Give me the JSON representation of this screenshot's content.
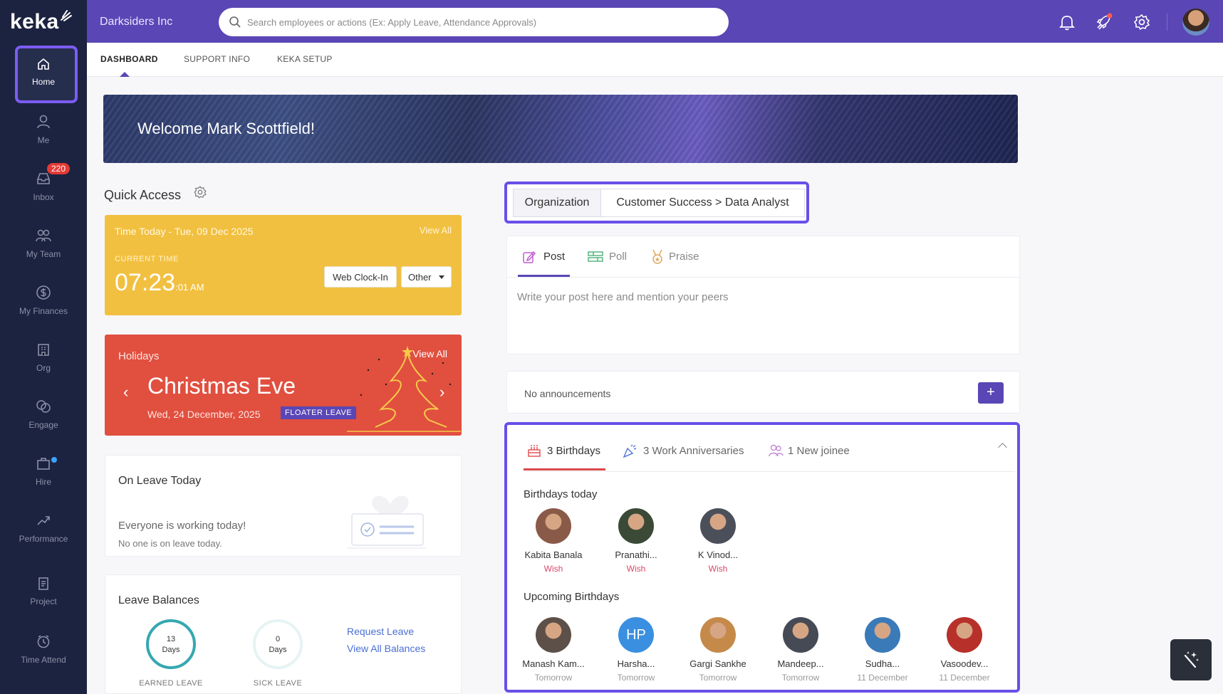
{
  "app": {
    "logo": "keka",
    "company": "Darksiders Inc"
  },
  "search": {
    "placeholder": "Search employees or actions (Ex: Apply Leave, Attendance Approvals)"
  },
  "sidebar": {
    "items": [
      {
        "label": "Home",
        "icon": "home-icon"
      },
      {
        "label": "Me",
        "icon": "user-icon"
      },
      {
        "label": "Inbox",
        "icon": "inbox-icon",
        "badge": "220"
      },
      {
        "label": "My Team",
        "icon": "team-icon"
      },
      {
        "label": "My Finances",
        "icon": "dollar-icon"
      },
      {
        "label": "Org",
        "icon": "building-icon"
      },
      {
        "label": "Engage",
        "icon": "engage-icon"
      },
      {
        "label": "Hire",
        "icon": "briefcase-icon"
      },
      {
        "label": "Performance",
        "icon": "trend-icon"
      },
      {
        "label": "Project",
        "icon": "clipboard-icon"
      },
      {
        "label": "Time Attend",
        "icon": "clock-icon"
      }
    ]
  },
  "subnav": {
    "tabs": [
      "DASHBOARD",
      "SUPPORT INFO",
      "KEKA SETUP"
    ],
    "active": "DASHBOARD"
  },
  "banner": {
    "text": "Welcome Mark Scottfield!"
  },
  "quick_access": {
    "title": "Quick Access"
  },
  "time_card": {
    "title": "Time Today - Tue, 09 Dec 2025",
    "view_all": "View All",
    "label": "CURRENT TIME",
    "time_main": "07:23",
    "time_sec": ":01 AM",
    "clock_in": "Web Clock-In",
    "other": "Other"
  },
  "holiday_card": {
    "title": "Holidays",
    "view_all": "View All",
    "name": "Christmas Eve",
    "date": "Wed, 24 December, 2025",
    "tag": "FLOATER LEAVE"
  },
  "on_leave": {
    "title": "On Leave Today",
    "message": "Everyone is working today!",
    "sub": "No one is on leave today."
  },
  "leave_balances": {
    "title": "Leave Balances",
    "items": [
      {
        "value": "13",
        "unit": "Days",
        "label": "EARNED LEAVE",
        "fill": 1.0
      },
      {
        "value": "0",
        "unit": "Days",
        "label": "SICK LEAVE",
        "fill": 0.0
      }
    ],
    "request": "Request Leave",
    "view_all": "View All Balances"
  },
  "feed_scope": {
    "org": "Organization",
    "team": "Customer Success > Data Analyst"
  },
  "post": {
    "tabs": [
      "Post",
      "Poll",
      "Praise"
    ],
    "placeholder": "Write your post here and mention your peers"
  },
  "announcements": {
    "text": "No announcements",
    "add": "+"
  },
  "celebrations": {
    "tabs": [
      "3 Birthdays",
      "3 Work Anniversaries",
      "1 New joinee"
    ],
    "today_title": "Birthdays today",
    "today": [
      {
        "name": "Kabita Banala",
        "action": "Wish",
        "color": "#8a5a48"
      },
      {
        "name": "Pranathi...",
        "action": "Wish",
        "color": "#3b4a36"
      },
      {
        "name": "K Vinod...",
        "action": "Wish",
        "color": "#4b4f5a"
      }
    ],
    "upcoming_title": "Upcoming Birthdays",
    "upcoming": [
      {
        "name": "Manash Kam...",
        "when": "Tomorrow",
        "color": "#5d5048",
        "initials": ""
      },
      {
        "name": "Harsha...",
        "when": "Tomorrow",
        "color": "#3a8fe0",
        "initials": "HP"
      },
      {
        "name": "Gargi Sankhe",
        "when": "Tomorrow",
        "color": "#c58a4a",
        "initials": ""
      },
      {
        "name": "Mandeep...",
        "when": "Tomorrow",
        "color": "#454a55",
        "initials": ""
      },
      {
        "name": "Sudha...",
        "when": "11 December",
        "color": "#3a7ab8",
        "initials": ""
      },
      {
        "name": "Vasoodev...",
        "when": "11 December",
        "color": "#b8302a",
        "initials": ""
      }
    ]
  },
  "colors": {
    "brand": "#5a46b5",
    "sidebar": "#1c2340",
    "highlight": "#6a4fe8",
    "time_card": "#f2c040",
    "holiday_card": "#e14f3f"
  }
}
